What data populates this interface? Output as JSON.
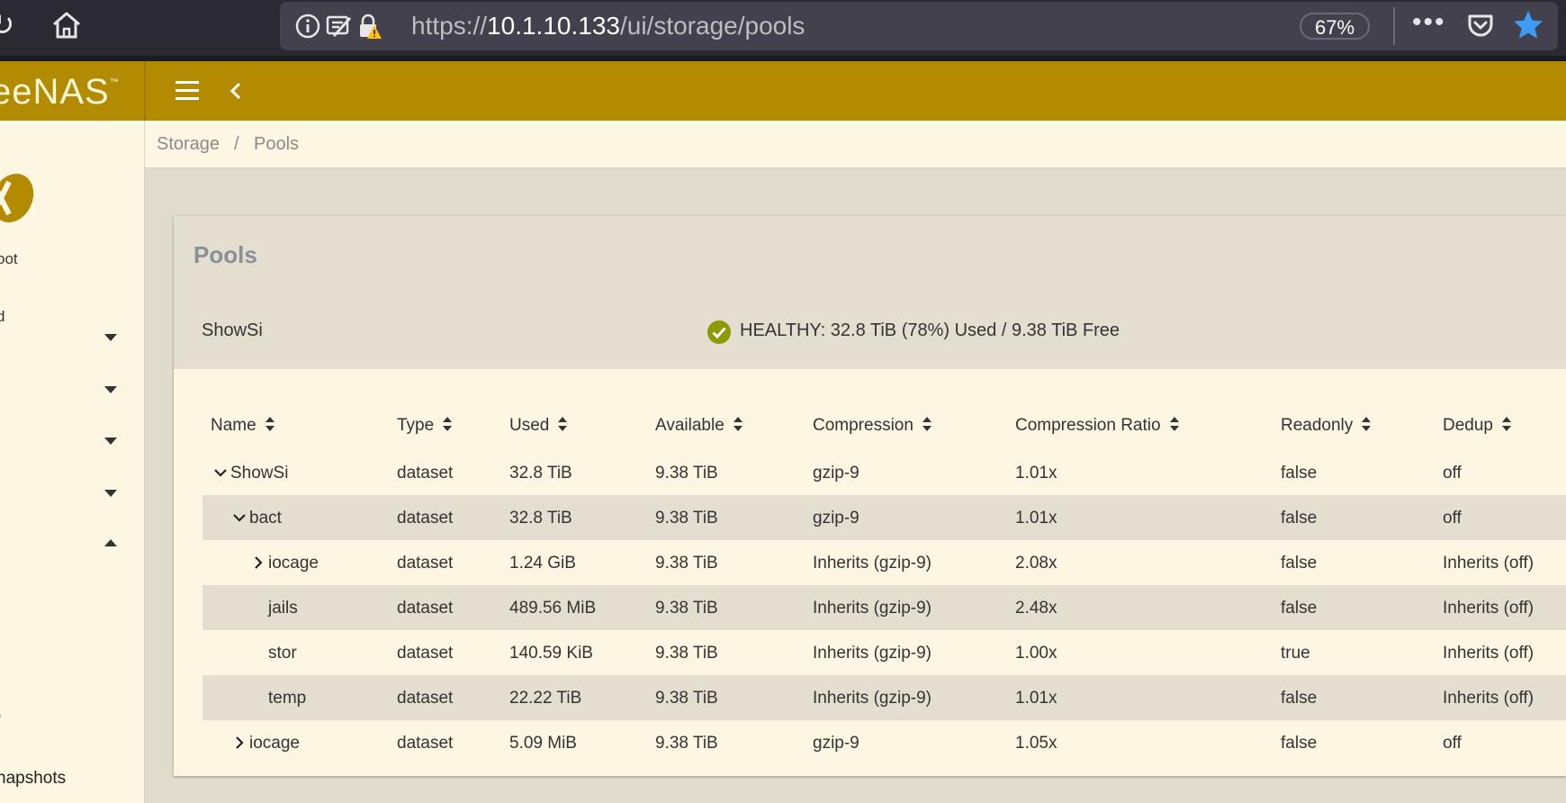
{
  "browser": {
    "url_prefix": "https://",
    "url_host": "10.1.10.133",
    "url_path": "/ui/storage/pools",
    "zoom": "67%",
    "more": "•••"
  },
  "app": {
    "brand": "eeNAS",
    "brand_mark": "™",
    "colors": {
      "header": "#b38b00",
      "panel": "#fdf6e2",
      "accent_ok": "#8a9a00"
    }
  },
  "sidebar": {
    "user": "oot",
    "role": "d",
    "mark": "'",
    "snapshots": "napshots"
  },
  "breadcrumb": {
    "items": [
      "Storage",
      "Pools"
    ],
    "sep": "/"
  },
  "card": {
    "title": "Pools",
    "pool_name": "ShowSi",
    "status": "HEALTHY: 32.8 TiB (78%) Used / 9.38 TiB Free"
  },
  "table": {
    "columns": [
      "Name",
      "Type",
      "Used",
      "Available",
      "Compression",
      "Compression Ratio",
      "Readonly",
      "Dedup"
    ],
    "rows": [
      {
        "name": "ShowSi",
        "type": "dataset",
        "used": "32.8 TiB",
        "available": "9.38 TiB",
        "compression": "gzip-9",
        "ratio": "1.01x",
        "readonly": "false",
        "dedup": "off",
        "expander": "expanded"
      },
      {
        "name": "bact",
        "type": "dataset",
        "used": "32.8 TiB",
        "available": "9.38 TiB",
        "compression": "gzip-9",
        "ratio": "1.01x",
        "readonly": "false",
        "dedup": "off",
        "expander": "expanded"
      },
      {
        "name": "iocage",
        "type": "dataset",
        "used": "1.24 GiB",
        "available": "9.38 TiB",
        "compression": "Inherits (gzip-9)",
        "ratio": "2.08x",
        "readonly": "false",
        "dedup": "Inherits (off)",
        "expander": "collapsed"
      },
      {
        "name": "jails",
        "type": "dataset",
        "used": "489.56 MiB",
        "available": "9.38 TiB",
        "compression": "Inherits (gzip-9)",
        "ratio": "2.48x",
        "readonly": "false",
        "dedup": "Inherits (off)",
        "expander": "none"
      },
      {
        "name": "stor",
        "type": "dataset",
        "used": "140.59 KiB",
        "available": "9.38 TiB",
        "compression": "Inherits (gzip-9)",
        "ratio": "1.00x",
        "readonly": "true",
        "dedup": "Inherits (off)",
        "expander": "none"
      },
      {
        "name": "temp",
        "type": "dataset",
        "used": "22.22 TiB",
        "available": "9.38 TiB",
        "compression": "Inherits (gzip-9)",
        "ratio": "1.01x",
        "readonly": "false",
        "dedup": "Inherits (off)",
        "expander": "none"
      },
      {
        "name": "iocage",
        "type": "dataset",
        "used": "5.09 MiB",
        "available": "9.38 TiB",
        "compression": "gzip-9",
        "ratio": "1.05x",
        "readonly": "false",
        "dedup": "off",
        "expander": "collapsed"
      }
    ]
  }
}
